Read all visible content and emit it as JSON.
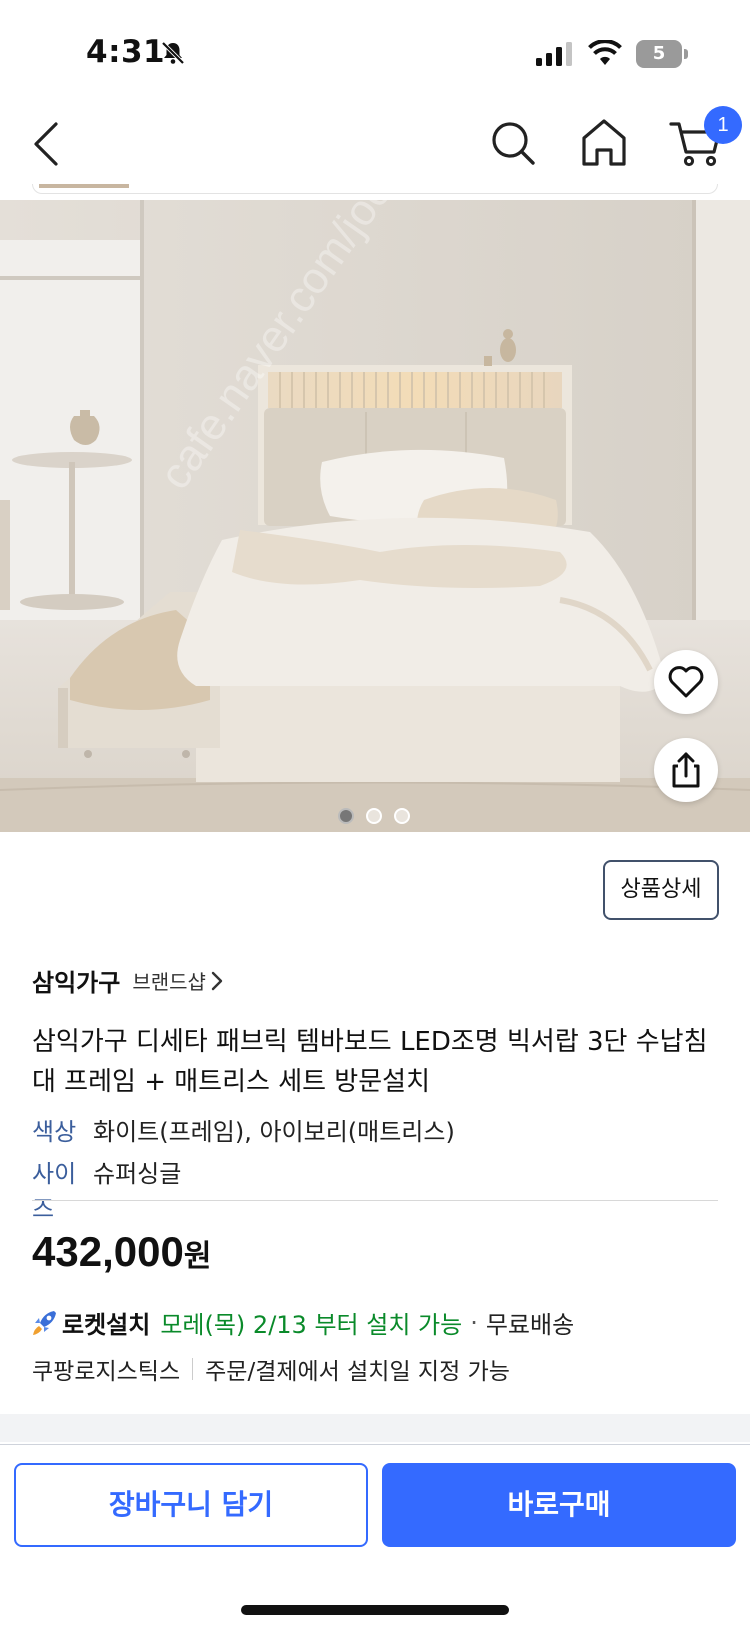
{
  "status_bar": {
    "time": "4:31",
    "battery": "5"
  },
  "nav": {
    "cart_count": "1"
  },
  "product_image": {
    "watermark": "cafe.naver.com/joonggonara",
    "slides_total": 3,
    "slide_active": 1
  },
  "detail_button_label": "상품상세",
  "brand": {
    "name": "삼익가구",
    "shop_link": "브랜드샵"
  },
  "title": "삼익가구 디세타 패브릭 템바보드 LED조명 빅서랍 3단 수납침대 프레임 + 매트리스 세트 방문설치",
  "options": {
    "color_label": "색상",
    "color_value": "화이트(프레임), 아이보리(매트리스)",
    "size_label": "사이즈",
    "size_value": "슈퍼싱글"
  },
  "price": {
    "amount": "432,000",
    "unit": "원"
  },
  "delivery": {
    "badge": "로켓설치",
    "arrival": "모레(목) 2/13 부터 설치 가능",
    "separator": "·",
    "shipping": "무료배송",
    "logistics": "쿠팡로지스틱스",
    "schedule_note": "주문/결제에서 설치일 지정 가능"
  },
  "bottom": {
    "add_to_cart": "장바구니 담기",
    "buy_now": "바로구매"
  },
  "colors": {
    "accent": "#346aff",
    "option_label": "#3b5e9c",
    "arrival_green": "#0a8a2a"
  },
  "icons": [
    "bell-slash-icon",
    "signal-icon",
    "wifi-icon",
    "battery-icon",
    "back-arrow-icon",
    "search-icon",
    "home-icon",
    "cart-icon",
    "heart-icon",
    "share-icon",
    "chevron-right-icon",
    "rocket-icon"
  ]
}
